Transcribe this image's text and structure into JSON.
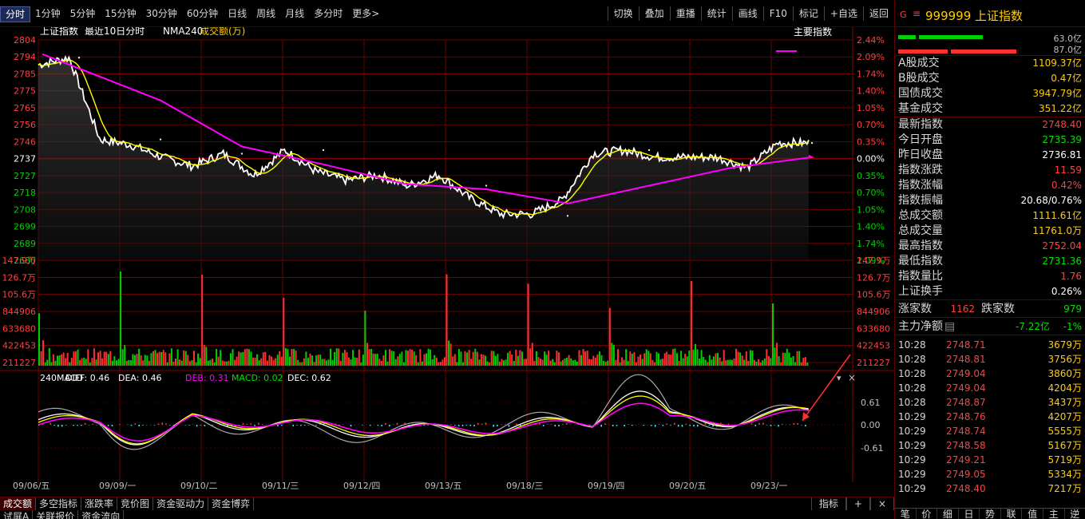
{
  "toolbar": {
    "periods": [
      "分时",
      "1分钟",
      "5分钟",
      "15分钟",
      "30分钟",
      "60分钟",
      "日线",
      "周线",
      "月线",
      "多分时",
      "更多>"
    ],
    "actions": [
      "切换",
      "叠加",
      "重播",
      "统计",
      "画线",
      "F10",
      "标记",
      "+自选",
      "返回"
    ]
  },
  "chart": {
    "header_name": "上证指数",
    "header_period": "最近10日分时",
    "header_nma": "NMA240",
    "header_volume_label": "成交额(万)",
    "main_indicator_button": "主要指数",
    "price_ticks": [
      "2804",
      "2794",
      "2785",
      "2775",
      "2765",
      "2756",
      "2746",
      "2737",
      "2727",
      "2718",
      "2708",
      "2699",
      "2689",
      "2680"
    ],
    "pct_ticks": [
      "2.44%",
      "2.09%",
      "1.74%",
      "1.40%",
      "1.05%",
      "0.70%",
      "0.35%",
      "0.00%",
      "0.35%",
      "0.70%",
      "1.05%",
      "1.40%",
      "1.74%",
      "2.09%"
    ],
    "vol_ticks": [
      "147.9万",
      "126.7万",
      "105.6万",
      "844906",
      "633680",
      "422453",
      "211227"
    ],
    "macd_header": {
      "name": "240MACD",
      "diff": "DIFF: 0.46",
      "dea": "DEA: 0.46",
      "deb": "DEB: 0.31",
      "macd": "MACD: 0.02",
      "dec": "DEC: 0.62"
    },
    "macd_ticks": [
      "0.61",
      "0.00",
      "-0.61"
    ],
    "dates": [
      "09/06/五",
      "09/09/一",
      "09/10/二",
      "09/11/三",
      "09/12/四",
      "09/13/五",
      "09/18/三",
      "09/19/四",
      "09/20/五",
      "09/23/一"
    ],
    "colors": {
      "grid": "#8b0000",
      "price": "#ffffff",
      "avg": "#ffff00",
      "nma": "#ff00ff",
      "up": "#ff3030",
      "down": "#00d000",
      "zero": "#c0c0c0"
    }
  },
  "chart_data": {
    "type": "line",
    "xlabel": "",
    "ylabel": "",
    "ylim": [
      2680,
      2804
    ],
    "x": [
      "09/06/五",
      "09/09/一",
      "09/10/二",
      "09/11/三",
      "09/12/四",
      "09/13/五",
      "09/18/三",
      "09/19/四",
      "09/20/五",
      "09/23/一"
    ],
    "series": [
      {
        "name": "",
        "values": [
          2794,
          2748,
          2740,
          2742,
          2722,
          2722,
          2705,
          2742,
          2736,
          2746
        ]
      },
      {
        "name": "NMA240",
        "values": [
          2796,
          2770,
          2744,
          2734,
          2723,
          2720,
          2712,
          2722,
          2732,
          2738
        ]
      }
    ],
    "volume_ylim": [
      0,
      1479000
    ],
    "macd_ylim": [
      -0.61,
      0.61
    ]
  },
  "bottom_tabs": {
    "row1": [
      "成交额",
      "多空指标",
      "涨跌率",
      "竞价图",
      "资金驱动力",
      "资金博弈"
    ],
    "row2": [
      "试屏A",
      "关联报价",
      "资金流向"
    ],
    "right": [
      "指标",
      "+",
      "×"
    ]
  },
  "panel": {
    "prefix": "G",
    "menu_icon": "≡",
    "code": "999999",
    "name": "上证指数",
    "buy_amount": "63.0亿",
    "sell_amount": "87.0亿",
    "volumes": [
      {
        "k": "A股成交",
        "v": "1109.37亿"
      },
      {
        "k": "B股成交",
        "v": "0.47亿"
      },
      {
        "k": "国债成交",
        "v": "3947.79亿"
      },
      {
        "k": "基金成交",
        "v": "351.22亿"
      }
    ],
    "stats": [
      {
        "k": "最新指数",
        "v": "2748.40",
        "c": "red"
      },
      {
        "k": "今日开盘",
        "v": "2735.39",
        "c": "green"
      },
      {
        "k": "昨日收盘",
        "v": "2736.81",
        "c": "white"
      },
      {
        "k": "指数涨跌",
        "v": "11.59",
        "c": "red"
      },
      {
        "k": "指数涨幅",
        "v": "0.42%",
        "c": "red"
      },
      {
        "k": "指数振幅",
        "v": "20.68/0.76%",
        "c": "white"
      },
      {
        "k": "总成交额",
        "v": "1111.61亿",
        "c": "yellow"
      },
      {
        "k": "总成交量",
        "v": "11761.0万",
        "c": "yellow"
      },
      {
        "k": "最高指数",
        "v": "2752.04",
        "c": "red"
      },
      {
        "k": "最低指数",
        "v": "2731.36",
        "c": "green"
      },
      {
        "k": "指数量比",
        "v": "1.76",
        "c": "red"
      },
      {
        "k": "上证换手",
        "v": "0.26%",
        "c": "white"
      }
    ],
    "up_label": "涨家数",
    "up_count": "1162",
    "down_label": "跌家数",
    "down_count": "979",
    "main_flow_label": "主力净额",
    "main_flow_value": "-7.22亿",
    "main_flow_pct": "-1%",
    "trades": [
      {
        "t": "10:28",
        "p": "2748.71",
        "v": "3679万"
      },
      {
        "t": "10:28",
        "p": "2748.81",
        "v": "3756万"
      },
      {
        "t": "10:28",
        "p": "2749.04",
        "v": "3860万"
      },
      {
        "t": "10:28",
        "p": "2749.04",
        "v": "4204万"
      },
      {
        "t": "10:28",
        "p": "2748.87",
        "v": "3437万"
      },
      {
        "t": "10:29",
        "p": "2748.76",
        "v": "4207万"
      },
      {
        "t": "10:29",
        "p": "2748.74",
        "v": "5555万"
      },
      {
        "t": "10:29",
        "p": "2748.58",
        "v": "5167万"
      },
      {
        "t": "10:29",
        "p": "2749.21",
        "v": "5719万"
      },
      {
        "t": "10:29",
        "p": "2749.05",
        "v": "5334万"
      },
      {
        "t": "10:29",
        "p": "2748.40",
        "v": "7217万"
      }
    ],
    "footer_tabs": [
      "笔",
      "价",
      "细",
      "日",
      "势",
      "联",
      "值",
      "主",
      "逆"
    ]
  }
}
